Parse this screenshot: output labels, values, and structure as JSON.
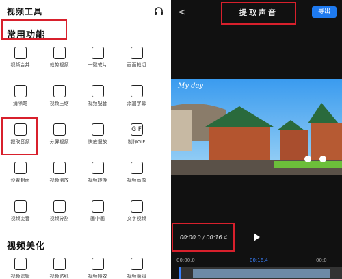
{
  "left": {
    "header": {
      "title": "视频工具"
    },
    "section1": {
      "title": "常用功能"
    },
    "tools": [
      {
        "label": "视频合并",
        "icon": "merge-icon"
      },
      {
        "label": "裁剪视频",
        "icon": "crop-icon"
      },
      {
        "label": "一键成片",
        "icon": "oneclick-icon"
      },
      {
        "label": "画面裁切",
        "icon": "trim-icon"
      },
      {
        "label": "消除笔",
        "icon": "eraser-icon"
      },
      {
        "label": "视频压缩",
        "icon": "compress-icon"
      },
      {
        "label": "视频配音",
        "icon": "dub-icon"
      },
      {
        "label": "添加字幕",
        "icon": "subtitle-icon"
      },
      {
        "label": "提取音频",
        "icon": "extract-audio-icon"
      },
      {
        "label": "分屏视频",
        "icon": "split-screen-icon"
      },
      {
        "label": "快放慢放",
        "icon": "speed-icon"
      },
      {
        "label": "制作GIF",
        "icon": "gif-icon"
      },
      {
        "label": "设置封面",
        "icon": "cover-icon"
      },
      {
        "label": "视频倒放",
        "icon": "reverse-icon"
      },
      {
        "label": "视频转换",
        "icon": "convert-icon"
      },
      {
        "label": "视频画像",
        "icon": "portrait-icon"
      },
      {
        "label": "视频变音",
        "icon": "voice-change-icon"
      },
      {
        "label": "视频分割",
        "icon": "split-icon"
      },
      {
        "label": "画中画",
        "icon": "pip-icon"
      },
      {
        "label": "文字视频",
        "icon": "text-video-icon"
      }
    ],
    "section2": {
      "title": "视频美化"
    },
    "section2_labels": [
      "视频滤镜",
      "视频贴纸",
      "视频特效",
      "视频涂鸦"
    ]
  },
  "right": {
    "title": "提取声音",
    "export_label": "导出",
    "time_display": "00:00.0 / 00:16.4",
    "play_label": "▶",
    "timeline": {
      "start": "00:00.0",
      "mid": "00:16.4",
      "end": "00:0"
    },
    "video_text": "My day"
  }
}
